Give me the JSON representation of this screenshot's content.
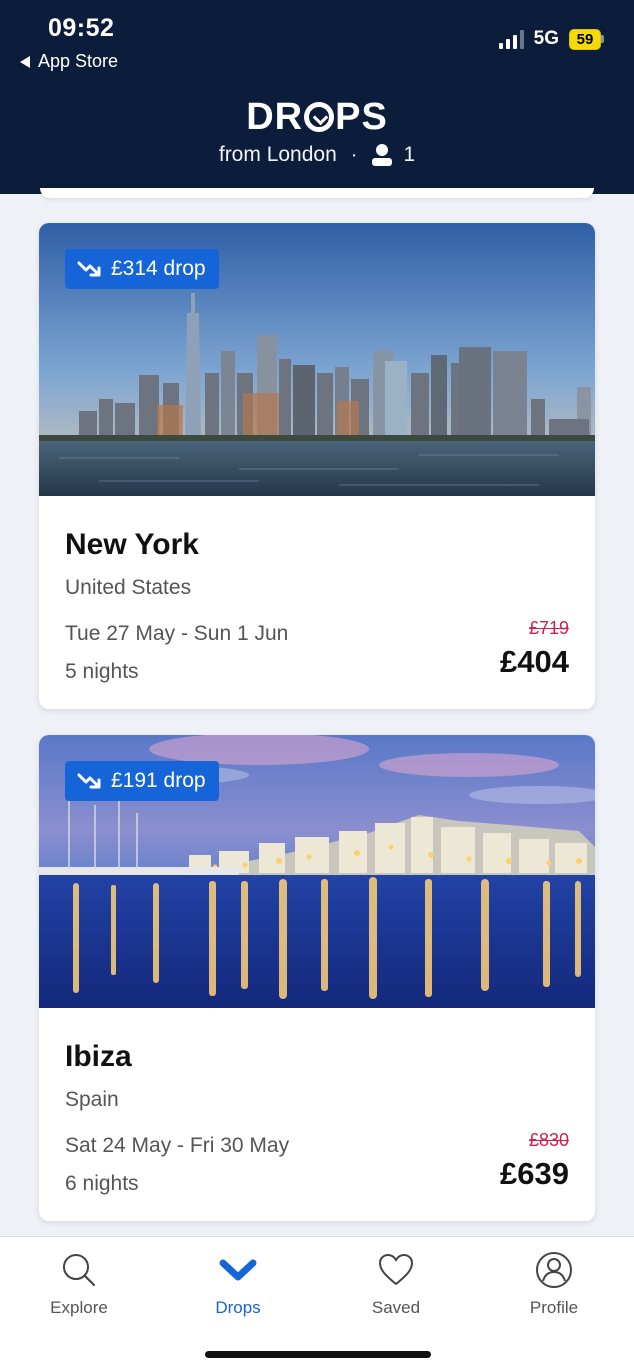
{
  "status_bar": {
    "time": "09:52",
    "back_label": "App Store",
    "network": "5G",
    "battery": "59"
  },
  "header": {
    "title_prefix": "DR",
    "title_suffix": "PS",
    "origin": "from London",
    "separator": "·",
    "passengers": "1"
  },
  "deals": [
    {
      "drop_label": "£314 drop",
      "city": "New York",
      "country": "United States",
      "dates": "Tue 27 May - Sun 1 Jun",
      "nights": "5 nights",
      "old_price": "£719",
      "new_price": "£404"
    },
    {
      "drop_label": "£191 drop",
      "city": "Ibiza",
      "country": "Spain",
      "dates": "Sat 24 May - Fri 30 May",
      "nights": "6 nights",
      "old_price": "£830",
      "new_price": "£639"
    }
  ],
  "tabbar": {
    "tabs": [
      {
        "label": "Explore",
        "icon": "search-icon"
      },
      {
        "label": "Drops",
        "icon": "chevron-down-icon"
      },
      {
        "label": "Saved",
        "icon": "heart-icon"
      },
      {
        "label": "Profile",
        "icon": "user-icon"
      }
    ],
    "active": "Drops",
    "active_color": "#1565d8"
  },
  "colors": {
    "header_bg": "#0b1d3a",
    "badge_bg": "#1565d8",
    "old_price": "#d11f4c"
  }
}
